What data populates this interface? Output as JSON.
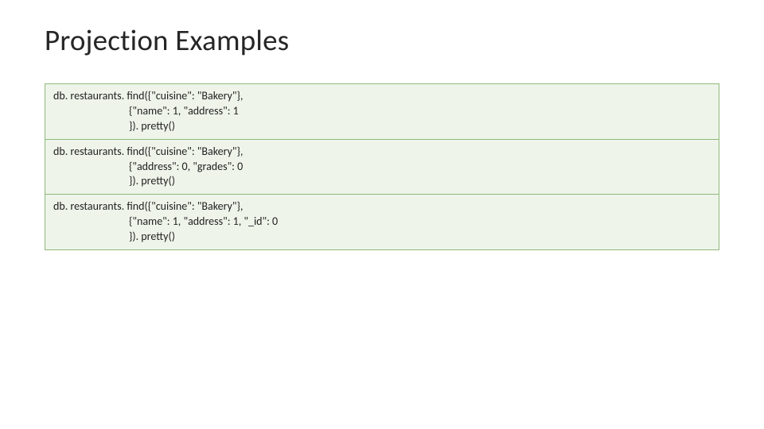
{
  "title": "Projection Examples",
  "rows": [
    {
      "line1": "db. restaurants. find({\"cuisine\": \"Bakery\"},",
      "line2": "                              {\"name\": 1, \"address\": 1",
      "line3": "                              }). pretty()"
    },
    {
      "line1": "db. restaurants. find({\"cuisine\": \"Bakery\"},",
      "line2": "                              {\"address\": 0, \"grades\": 0",
      "line3": "                              }). pretty()"
    },
    {
      "line1": "db. restaurants. find({\"cuisine\": \"Bakery\"},",
      "line2": "                              {\"name\": 1, \"address\": 1, \"_id\": 0",
      "line3": "                              }). pretty()"
    }
  ]
}
